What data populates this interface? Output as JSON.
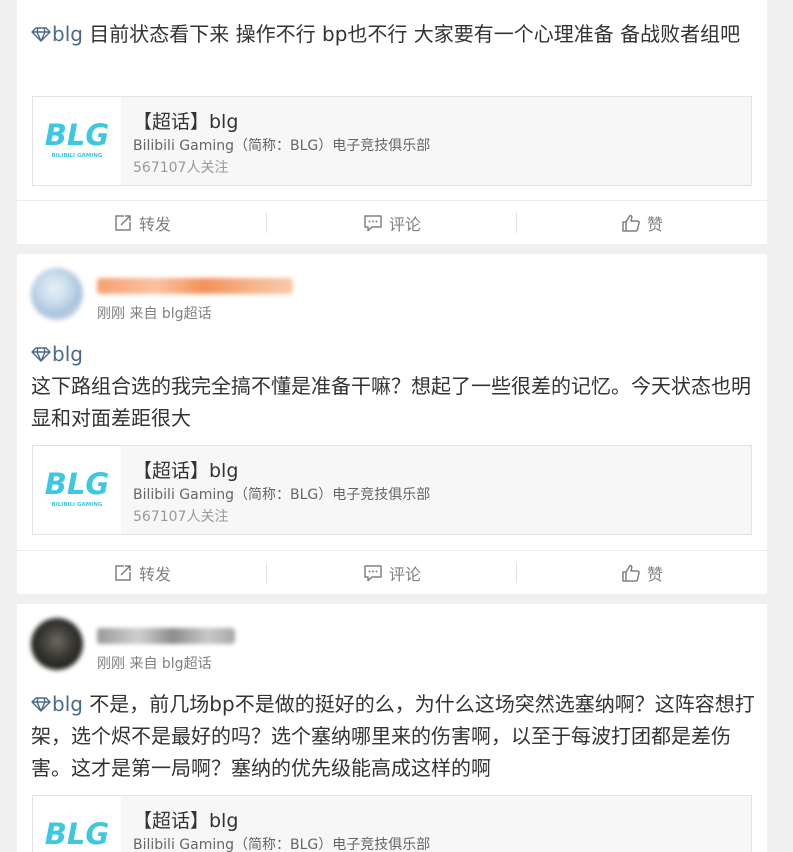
{
  "posts": [
    {
      "tag": "blg",
      "text": " 目前状态看下来 操作不行 bp也不行 大家要有一个心理准备 备战败者组吧",
      "topic": {
        "title": "【超话】blg",
        "desc": "Bilibili Gaming（简称：BLG）电子竞技俱乐部",
        "followers": "567107人关注"
      },
      "actions": {
        "forward": "转发",
        "comment": "评论",
        "like": "赞"
      }
    },
    {
      "meta": "刚刚 来自 blg超话",
      "tag": "blg",
      "text": "这下路组合选的我完全搞不懂是准备干嘛？想起了一些很差的记忆。今天状态也明显和对面差距很大",
      "topic": {
        "title": "【超话】blg",
        "desc": "Bilibili Gaming（简称：BLG）电子竞技俱乐部",
        "followers": "567107人关注"
      },
      "actions": {
        "forward": "转发",
        "comment": "评论",
        "like": "赞"
      }
    },
    {
      "meta": "刚刚 来自 blg超话",
      "tag": "blg",
      "text": " 不是，前几场bp不是做的挺好的么，为什么这场突然选塞纳啊？这阵容想打架，选个烬不是最好的吗？选个塞纳哪里来的伤害啊，以至于每波打团都是差伤害。这才是第一局啊？塞纳的优先级能高成这样的啊",
      "topic": {
        "title": "【超话】blg",
        "desc": "Bilibili Gaming（简称：BLG）电子竞技俱乐部",
        "followers": ""
      }
    }
  ],
  "logo_text": "BLG",
  "logo_subtext": "BILIBILI GAMING",
  "colors": {
    "tag": "#4a6a8d",
    "logo": "#3ec8e0",
    "text": "#333333",
    "muted": "#808080"
  },
  "icons": {
    "tag": "diamond-icon",
    "forward": "forward-icon",
    "comment": "comment-icon",
    "like": "thumbs-up-icon"
  }
}
